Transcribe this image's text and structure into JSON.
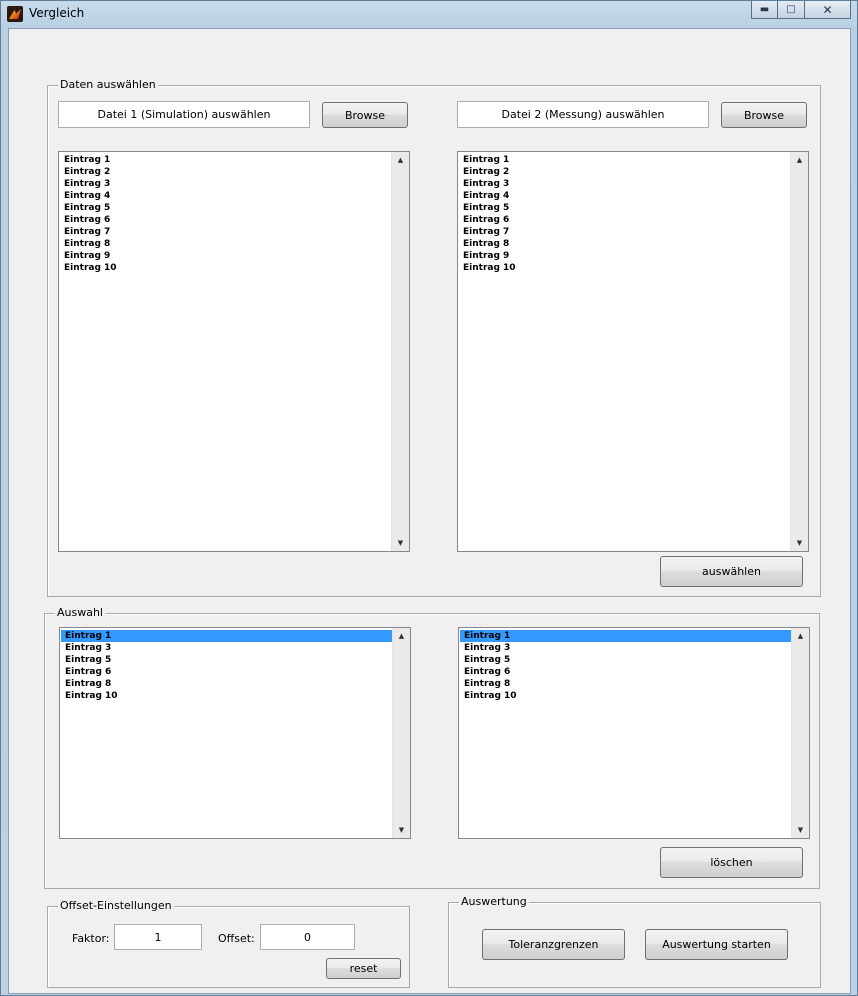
{
  "window": {
    "title": "Vergleich",
    "min_icon": "minimize-icon",
    "max_icon": "maximize-icon",
    "close_icon": "close-icon"
  },
  "daten": {
    "title": "Daten auswählen",
    "file1_label": "Datei 1 (Simulation) auswählen",
    "file2_label": "Datei 2 (Messung) auswählen",
    "browse1": "Browse",
    "browse2": "Browse",
    "list1": [
      "Eintrag 1",
      "Eintrag 2",
      "Eintrag 3",
      "Eintrag 4",
      "Eintrag 5",
      "Eintrag 6",
      "Eintrag 7",
      "Eintrag 8",
      "Eintrag 9",
      "Eintrag 10"
    ],
    "list2": [
      "Eintrag 1",
      "Eintrag 2",
      "Eintrag 3",
      "Eintrag 4",
      "Eintrag 5",
      "Eintrag 6",
      "Eintrag 7",
      "Eintrag 8",
      "Eintrag 9",
      "Eintrag 10"
    ],
    "select_button": "auswählen"
  },
  "auswahl": {
    "title": "Auswahl",
    "list1": [
      "Eintrag 1",
      "Eintrag 3",
      "Eintrag 5",
      "Eintrag 6",
      "Eintrag 8",
      "Eintrag 10"
    ],
    "list2": [
      "Eintrag 1",
      "Eintrag 3",
      "Eintrag 5",
      "Eintrag 6",
      "Eintrag 8",
      "Eintrag 10"
    ],
    "selected_index": 0,
    "delete_button": "löschen"
  },
  "offset": {
    "title": "Offset-Einstellungen",
    "faktor_label": "Faktor:",
    "faktor_value": "1",
    "offset_label": "Offset:",
    "offset_value": "0",
    "reset_button": "reset"
  },
  "auswertung": {
    "title": "Auswertung",
    "tolerance_button": "Toleranzgrenzen",
    "start_button": "Auswertung starten"
  },
  "colors": {
    "selection": "#3399ff",
    "client_bg": "#f0f0f0"
  }
}
